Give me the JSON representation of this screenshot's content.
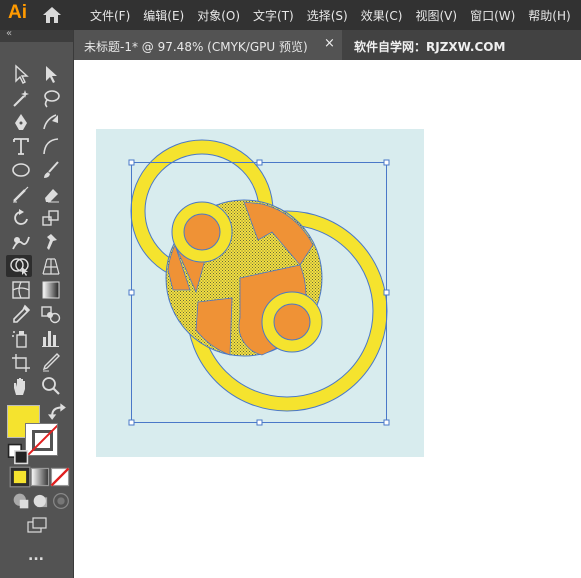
{
  "app": {
    "logo": "Ai"
  },
  "menu": {
    "items": [
      "文件(F)",
      "编辑(E)",
      "对象(O)",
      "文字(T)",
      "选择(S)",
      "效果(C)",
      "视图(V)",
      "窗口(W)",
      "帮助(H)"
    ]
  },
  "tabs": {
    "active_label": "未标题-1* @ 97.48% (CMYK/GPU 预览)",
    "close_glyph": "×",
    "second_label": "软件自学网：RJZXW.COM"
  },
  "toolbar": {
    "collapse_glyph": "«",
    "more_glyph": "...",
    "selected_tool": "shape-builder-tool"
  },
  "colors": {
    "fill": "#f5e32e",
    "stroke": "none",
    "artboard": "#d8ecee",
    "orange": "#ef9236",
    "ring_yellow": "#f5e32e",
    "outline_blue": "#4a78c8"
  }
}
